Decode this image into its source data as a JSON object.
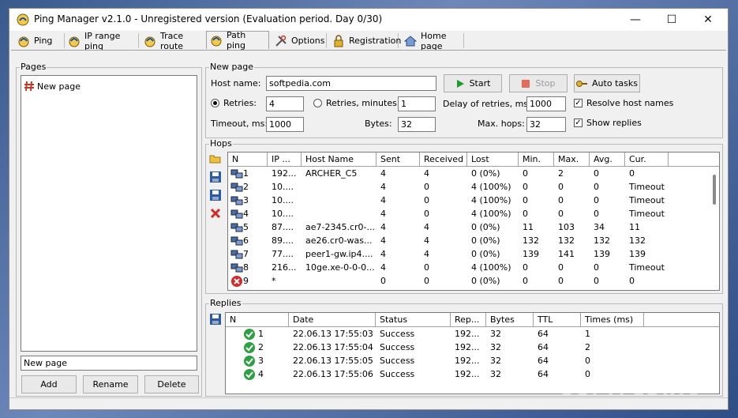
{
  "window": {
    "title": "Ping Manager v2.1.0 - Unregistered version (Evaluation period. Day 0/30)",
    "minimize_glyph": "—",
    "maximize_glyph": "☐",
    "close_glyph": "✕"
  },
  "tabs": [
    {
      "label": "Ping",
      "icon": "ping-icon",
      "active": false
    },
    {
      "label": "IP range ping",
      "icon": "ping-icon",
      "active": false
    },
    {
      "label": "Trace route",
      "icon": "ping-icon",
      "active": false
    },
    {
      "label": "Path ping",
      "icon": "ping-icon",
      "active": true
    },
    {
      "label": "Options",
      "icon": "tools-icon",
      "active": false
    },
    {
      "label": "Registration",
      "icon": "lock-icon",
      "active": false
    },
    {
      "label": "Home page",
      "icon": "home-icon",
      "active": false
    }
  ],
  "pages": {
    "group_label": "Pages",
    "items": [
      {
        "label": "New page"
      }
    ],
    "name_input_value": "New page",
    "add_label": "Add",
    "rename_label": "Rename",
    "delete_label": "Delete"
  },
  "new_page": {
    "group_label": "New page",
    "host_label": "Host name:",
    "host_value": "softpedia.com",
    "start_label": "Start",
    "stop_label": "Stop",
    "auto_tasks_label": "Auto tasks",
    "retries_label": "Retries:",
    "retries_value": "4",
    "retries_minutes_label": "Retries, minutes:",
    "retries_minutes_value": "1",
    "delay_label": "Delay of retries, ms:",
    "delay_value": "1000",
    "resolve_label": "Resolve host names",
    "resolve_checked": true,
    "timeout_label": "Timeout, ms:",
    "timeout_value": "1000",
    "bytes_label": "Bytes:",
    "bytes_value": "32",
    "maxhops_label": "Max. hops:",
    "maxhops_value": "32",
    "show_replies_label": "Show replies",
    "show_replies_checked": true
  },
  "hops": {
    "group_label": "Hops",
    "columns": [
      "N",
      "IP ...",
      "Host Name",
      "Sent",
      "Received",
      "Lost",
      "Min.",
      "Max.",
      "Avg.",
      "Cur."
    ],
    "rows": [
      {
        "icon": "ok",
        "cells": [
          "1",
          "192...",
          "ARCHER_C5",
          "4",
          "4",
          "0 (0%)",
          "0",
          "2",
          "0",
          "0"
        ]
      },
      {
        "icon": "ok",
        "cells": [
          "2",
          "10....",
          "",
          "4",
          "0",
          "4 (100%)",
          "0",
          "0",
          "0",
          "Timeout"
        ]
      },
      {
        "icon": "ok",
        "cells": [
          "3",
          "10....",
          "",
          "4",
          "0",
          "4 (100%)",
          "0",
          "0",
          "0",
          "Timeout"
        ]
      },
      {
        "icon": "ok",
        "cells": [
          "4",
          "10....",
          "",
          "4",
          "0",
          "4 (100%)",
          "0",
          "0",
          "0",
          "Timeout"
        ]
      },
      {
        "icon": "ok",
        "cells": [
          "5",
          "87....",
          "ae7-2345.cr0-...",
          "4",
          "4",
          "0 (0%)",
          "11",
          "103",
          "34",
          "11"
        ]
      },
      {
        "icon": "ok",
        "cells": [
          "6",
          "89....",
          "ae26.cr0-was...",
          "4",
          "4",
          "0 (0%)",
          "132",
          "132",
          "132",
          "132"
        ]
      },
      {
        "icon": "ok",
        "cells": [
          "7",
          "77....",
          "peer1-gw.ip4....",
          "4",
          "4",
          "0 (0%)",
          "139",
          "141",
          "139",
          "139"
        ]
      },
      {
        "icon": "ok",
        "cells": [
          "8",
          "216...",
          "10ge.xe-0-0-0...",
          "4",
          "0",
          "4 (100%)",
          "0",
          "0",
          "0",
          "Timeout"
        ]
      },
      {
        "icon": "error",
        "cells": [
          "9",
          "*",
          "",
          "0",
          "0",
          "0 (0%)",
          "0",
          "0",
          "0",
          "0"
        ]
      }
    ]
  },
  "replies": {
    "group_label": "Replies",
    "columns": [
      "N",
      "Date",
      "Status",
      "Rep...",
      "Bytes",
      "TTL",
      "Times (ms)"
    ],
    "rows": [
      {
        "cells": [
          "1",
          "22.06.13  17:55:03",
          "Success",
          "192...",
          "32",
          "64",
          "1"
        ]
      },
      {
        "cells": [
          "2",
          "22.06.13  17:55:04",
          "Success",
          "192...",
          "32",
          "64",
          "2"
        ]
      },
      {
        "cells": [
          "3",
          "22.06.13  17:55:05",
          "Success",
          "192...",
          "32",
          "64",
          "0"
        ]
      },
      {
        "cells": [
          "4",
          "22.06.13  17:55:06",
          "Success",
          "192...",
          "32",
          "64",
          "0"
        ]
      }
    ]
  },
  "watermark": "SOFTPEDIA®",
  "colors": {
    "start_green": "#1a9c2a",
    "stop_red": "#e23b2a",
    "ok_green": "#2ea043",
    "error_red": "#d62828"
  }
}
